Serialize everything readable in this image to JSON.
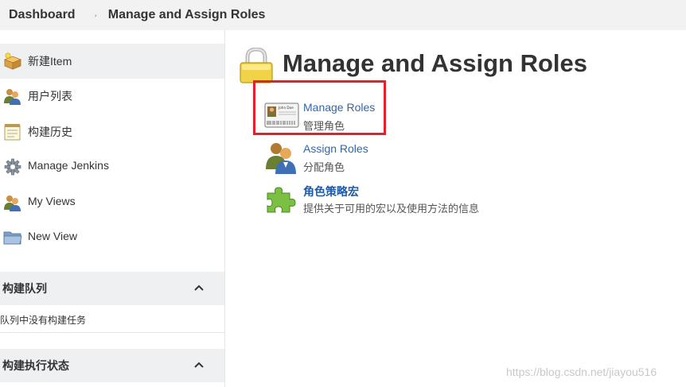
{
  "breadcrumb": {
    "items": [
      "Dashboard",
      "Manage and Assign Roles"
    ],
    "separator": "›"
  },
  "sidebar": {
    "tasks": [
      {
        "label": "新建Item",
        "icon": "new-item-icon"
      },
      {
        "label": "用户列表",
        "icon": "users-icon"
      },
      {
        "label": "构建历史",
        "icon": "notepad-icon"
      },
      {
        "label": "Manage Jenkins",
        "icon": "gear-icon"
      },
      {
        "label": "My Views",
        "icon": "user-views-icon"
      },
      {
        "label": "New View",
        "icon": "folder-icon"
      }
    ],
    "build_queue": {
      "title": "构建队列",
      "empty_text": "队列中没有构建任务"
    },
    "executor_status": {
      "title": "构建执行状态"
    }
  },
  "main": {
    "title": "Manage and Assign Roles",
    "entries": [
      {
        "link": "Manage Roles",
        "description": "管理角色",
        "icon": "id-card-icon",
        "card_name": "John Doe"
      },
      {
        "link": "Assign Roles",
        "description": "分配角色",
        "icon": "users-icon"
      },
      {
        "link": "角色策略宏",
        "description": "提供关于可用的宏以及使用方法的信息",
        "icon": "puzzle-icon"
      }
    ]
  },
  "watermark": "https://blog.csdn.net/jiayou516",
  "colors": {
    "link": "#3366aa",
    "highlight": "#e5202a",
    "panel": "#eef0f2"
  }
}
